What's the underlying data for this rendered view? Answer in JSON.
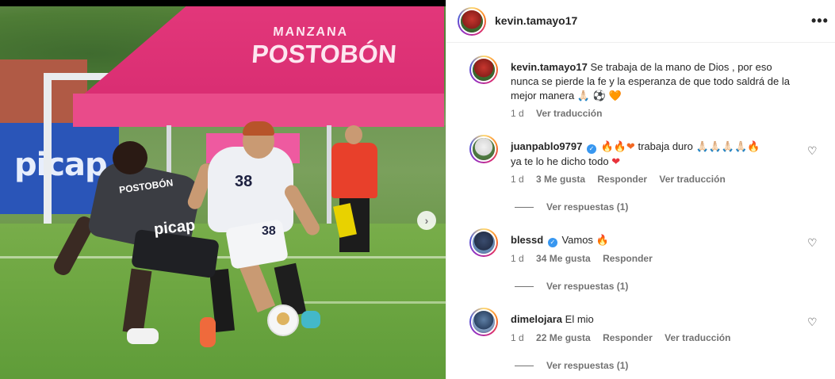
{
  "photo": {
    "banner_brand": "POSTOBÓN",
    "banner_sub": "MANZANA",
    "board_text": "picap",
    "player1_shirt_text": "POSTOBÓN",
    "player1_sponsor": "picap",
    "player2_number": "38",
    "player2_shorts_number": "38",
    "next_icon": "›"
  },
  "header": {
    "username": "kevin.tamayo17",
    "more_icon": "•••"
  },
  "caption": {
    "username": "kevin.tamayo17",
    "text": "Se trabaja de la mano de Dios , por eso nunca se pierde la fe y la esperanza de que todo saldrá de la mejor manera",
    "emojis": [
      "🙏🏻",
      "⚽",
      "🧡"
    ],
    "time": "1 d",
    "translate": "Ver traducción"
  },
  "comments": [
    {
      "username": "juanpablo9797",
      "verified": true,
      "pre_emojis": "🔥🔥❤",
      "text": "trabaja duro",
      "post_emojis": "🙏🏻🙏🏻🙏🏻🙏🏻🔥",
      "text2": "ya te lo he dicho todo",
      "post2_emoji": "❤",
      "time": "1 d",
      "likes": "3 Me gusta",
      "reply": "Responder",
      "translate": "Ver traducción",
      "view_replies": "Ver respuestas (1)"
    },
    {
      "username": "blessd",
      "verified": true,
      "text": "Vamos",
      "post_emojis": "🔥",
      "time": "1 d",
      "likes": "34 Me gusta",
      "reply": "Responder",
      "view_replies": "Ver respuestas (1)"
    },
    {
      "username": "dimelojara",
      "verified": false,
      "text": "El mio",
      "time": "1 d",
      "likes": "22 Me gusta",
      "reply": "Responder",
      "translate": "Ver traducción",
      "view_replies": "Ver respuestas (1)"
    }
  ],
  "icons": {
    "heart": "♡",
    "verified": "✓"
  }
}
